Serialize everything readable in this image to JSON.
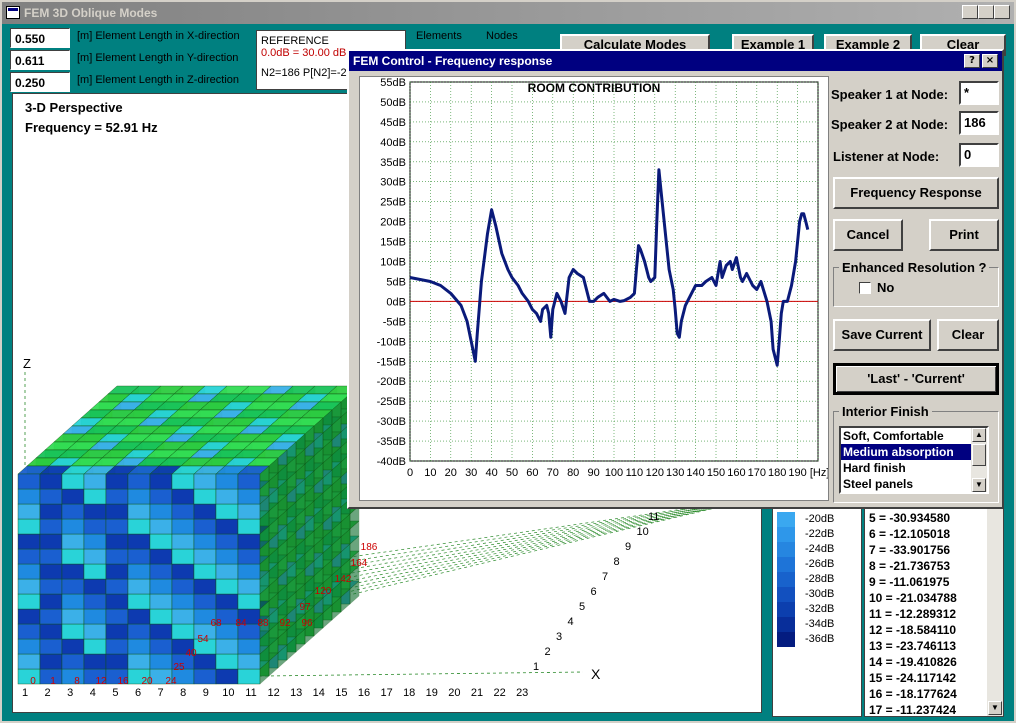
{
  "window": {
    "title": "FEM 3D Oblique Modes",
    "min": "_",
    "max": "□",
    "close": "×"
  },
  "inputs": [
    {
      "value": "0.550",
      "label": "[m] Element Length in X-direction"
    },
    {
      "value": "0.611",
      "label": "[m] Element Length in Y-direction"
    },
    {
      "value": "0.250",
      "label": "[m] Element Length in Z-direction"
    }
  ],
  "reference": {
    "title": "REFERENCE",
    "line1": "0.0dB = 30.00 dB",
    "line2": "N2=186  P[N2]=-2"
  },
  "top_labels": {
    "elements": "Elements",
    "nodes": "Nodes"
  },
  "top_buttons": {
    "calc": "Calculate Modes",
    "ex1": "Example 1",
    "ex2": "Example 2",
    "clear": "Clear"
  },
  "view": {
    "title": "3-D Perspective",
    "freq": "Frequency = 52.91  Hz",
    "z": "Z",
    "x": "X",
    "x_ticks": [
      "1",
      "2",
      "3",
      "4",
      "5",
      "6",
      "7",
      "8",
      "9",
      "10",
      "11",
      "12",
      "13",
      "14",
      "15",
      "16",
      "17",
      "18",
      "19",
      "20",
      "21",
      "22",
      "23"
    ],
    "red_nodes": [
      "0",
      "1",
      "8",
      "12",
      "16",
      "20",
      "24",
      "25",
      "40",
      "54",
      "68",
      "84",
      "88",
      "92",
      "96",
      "97",
      "120",
      "142",
      "164",
      "186"
    ],
    "y_ticks": [
      "1",
      "2",
      "3",
      "4",
      "5",
      "6",
      "7",
      "8",
      "9",
      "10",
      "11"
    ]
  },
  "legend_levels": [
    "-20dB",
    "-22dB",
    "-24dB",
    "-26dB",
    "-28dB",
    "-30dB",
    "-32dB",
    "-34dB",
    "-36dB"
  ],
  "mode_list": [
    "5 = -30.934580",
    "6 = -12.105018",
    "7 = -33.901756",
    "8 = -21.736753",
    "9 = -11.061975",
    "10 = -21.034788",
    "11 = -12.289312",
    "12 = -18.584110",
    "13 = -23.746113",
    "14 = -19.410826",
    "15 = -24.117142",
    "16 = -18.177624",
    "17 = -11.237424"
  ],
  "dialog": {
    "title": "FEM Control - Frequency response",
    "help": "?",
    "close": "×",
    "speaker1_label": "Speaker 1 at Node:",
    "speaker1": "*",
    "speaker2_label": "Speaker 2 at Node:",
    "speaker2": "186",
    "listener_label": "Listener at Node:",
    "listener": "0",
    "freq_btn": "Frequency Response",
    "cancel": "Cancel",
    "print": "Print",
    "enhanced_label": "Enhanced Resolution ?",
    "enhanced_opt": "No",
    "save": "Save Current",
    "clear": "Clear",
    "diff": "'Last' - 'Current'",
    "finish_label": "Interior Finish",
    "finish_items": [
      "Soft, Comfortable",
      "Medium absorption",
      "Hard finish",
      "Steel panels"
    ],
    "finish_selected": "Medium absorption"
  },
  "chart_data": {
    "type": "line",
    "title": "ROOM CONTRIBUTION",
    "xunit": "[Hz]",
    "xlim": [
      0,
      200
    ],
    "ylim": [
      -40,
      55
    ],
    "x_ticks": [
      "0",
      "10",
      "20",
      "30",
      "40",
      "50",
      "60",
      "70",
      "80",
      "90",
      "100",
      "110",
      "120",
      "130",
      "140",
      "150",
      "160",
      "170",
      "180",
      "190"
    ],
    "y_ticks": [
      "55dB",
      "50dB",
      "45dB",
      "40dB",
      "35dB",
      "30dB",
      "25dB",
      "20dB",
      "15dB",
      "10dB",
      "5dB",
      "0dB",
      "-5dB",
      "-10dB",
      "-15dB",
      "-20dB",
      "-25dB",
      "-30dB",
      "-35dB",
      "-40dB"
    ],
    "reference_line": 0,
    "series": [
      {
        "color": "#0a1a7a",
        "x": [
          0,
          5,
          10,
          15,
          20,
          25,
          28,
          30,
          32,
          33,
          35,
          38,
          40,
          42,
          45,
          48,
          50,
          53,
          55,
          58,
          60,
          62,
          64,
          65,
          67,
          68,
          69,
          70,
          72,
          74,
          76,
          78,
          80,
          82,
          85,
          88,
          90,
          92,
          95,
          98,
          100,
          103,
          105,
          108,
          110,
          111,
          112,
          113,
          115,
          117,
          118,
          120,
          121,
          122,
          123,
          125,
          127,
          129,
          130,
          131,
          132,
          133,
          135,
          138,
          140,
          143,
          145,
          148,
          150,
          152,
          153,
          155,
          157,
          158,
          160,
          162,
          163,
          165,
          168,
          170,
          172,
          175,
          177,
          178,
          180,
          181,
          182,
          183,
          185,
          187,
          189,
          190,
          191,
          192,
          193,
          194,
          195
        ],
        "y": [
          6,
          5.5,
          5,
          4,
          2,
          -1,
          -5,
          -10,
          -15,
          -8,
          5,
          17,
          23,
          19,
          12,
          8,
          6,
          4,
          2,
          0,
          -2,
          -3,
          -5,
          -2,
          -1,
          -3,
          -9,
          -2,
          2,
          0,
          -3,
          6,
          8,
          7,
          6,
          0,
          0,
          1,
          2,
          0,
          0.5,
          0,
          0.2,
          1,
          2,
          8,
          14,
          13,
          10,
          6,
          5,
          6,
          20,
          33,
          28,
          18,
          8,
          3,
          -2,
          -8,
          -9,
          -5,
          -1,
          2,
          4,
          4,
          5,
          6,
          4,
          10,
          6,
          9,
          10,
          8,
          11,
          6,
          5,
          7,
          4,
          3,
          5,
          0,
          -5,
          -12,
          -16,
          -10,
          -3,
          0,
          0,
          4,
          10,
          15,
          20,
          22,
          22,
          20,
          18
        ]
      }
    ]
  }
}
